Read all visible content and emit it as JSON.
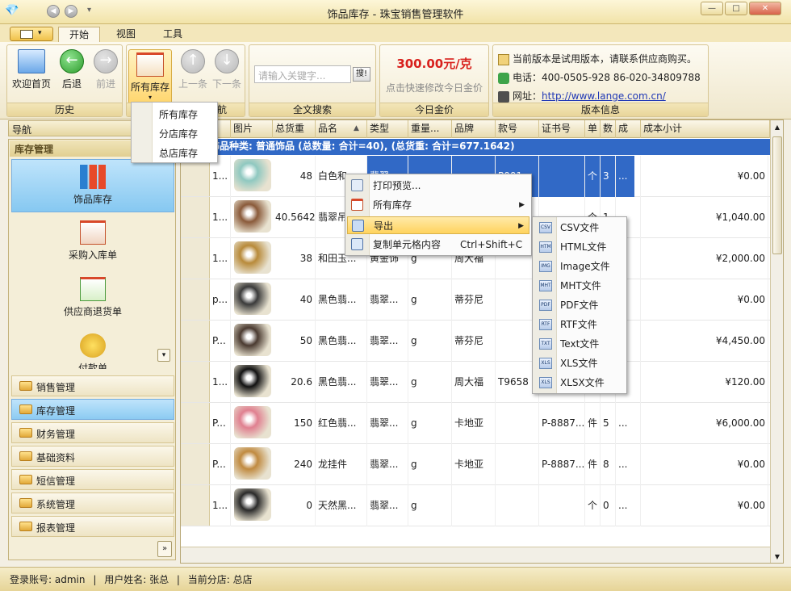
{
  "window": {
    "title": "饰品库存 - 珠宝销售管理软件"
  },
  "tabs": [
    "开始",
    "视图",
    "工具"
  ],
  "ribbon": {
    "history": {
      "home": "欢迎首页",
      "back": "后退",
      "forward": "前进",
      "label": "历史"
    },
    "nav": {
      "all_stock": "所有库存",
      "prev": "上一条",
      "next": "下一条",
      "label": "导航"
    },
    "search": {
      "placeholder": "请输入关键字...",
      "button": "搜!",
      "label": "全文搜索"
    },
    "gold": {
      "price": "300.00元/克",
      "tip": "点击快速修改今日金价",
      "label": "今日金价"
    },
    "version": {
      "notice": "当前版本是试用版本，请联系供应商购买。",
      "phone_label": "电话：",
      "phone": "400-0505-928  86-020-34809788",
      "url_label": "网址：",
      "url": "http://www.lange.com.cn/",
      "label": "版本信息"
    }
  },
  "dropdown": [
    "所有库存",
    "分店库存",
    "总店库存"
  ],
  "sidebar": {
    "header": "导航",
    "section": "库存管理",
    "big_items": [
      "饰品库存",
      "采购入库单",
      "供应商退货单",
      "付款单"
    ],
    "items": [
      "销售管理",
      "库存管理",
      "财务管理",
      "基础资料",
      "短信管理",
      "系统管理",
      "报表管理"
    ]
  },
  "grid": {
    "columns": [
      "图片",
      "总货重",
      "品名",
      "类型",
      "重量...",
      "品牌",
      "款号",
      "证书号",
      "单",
      "数",
      "成",
      "成本小计"
    ],
    "group_row": "饰品种类: 普通饰品 (总数量: 合计=40), (总货重: 合计=677.1642)",
    "rows": [
      {
        "id": "1...",
        "weight": "48",
        "name": "白色和...",
        "type": "翡翠...",
        "unit_w": "",
        "brand": "",
        "style": "P001",
        "cert": "",
        "unit": "个",
        "qty": "3",
        "c": "...",
        "cost": "¥0.00"
      },
      {
        "id": "1...",
        "weight": "40.5642",
        "name": "翡翠吊...",
        "type": "翡翠...",
        "unit_w": "",
        "brand": "",
        "style": "",
        "cert": "",
        "unit": "个",
        "qty": "1",
        "c": "...",
        "cost": "¥1,040.00"
      },
      {
        "id": "1...",
        "weight": "38",
        "name": "和田玉...",
        "type": "黄金饰",
        "unit_w": "g",
        "brand": "周大福",
        "style": "",
        "cert": "",
        "unit": "",
        "qty": "",
        "c": "",
        "cost": "¥2,000.00"
      },
      {
        "id": "p...",
        "weight": "40",
        "name": "黑色翡...",
        "type": "翡翠...",
        "unit_w": "g",
        "brand": "蒂芬尼",
        "style": "",
        "cert": "",
        "unit": "",
        "qty": "",
        "c": "",
        "cost": "¥0.00"
      },
      {
        "id": "P...",
        "weight": "50",
        "name": "黑色翡...",
        "type": "翡翠...",
        "unit_w": "g",
        "brand": "蒂芬尼",
        "style": "",
        "cert": "",
        "unit": "",
        "qty": "",
        "c": "",
        "cost": "¥4,450.00"
      },
      {
        "id": "1...",
        "weight": "20.6",
        "name": "黑色翡...",
        "type": "翡翠...",
        "unit_w": "g",
        "brand": "周大福",
        "style": "T9658",
        "cert": "",
        "unit": "",
        "qty": "",
        "c": "",
        "cost": "¥120.00"
      },
      {
        "id": "P...",
        "weight": "150",
        "name": "红色翡...",
        "type": "翡翠...",
        "unit_w": "g",
        "brand": "卡地亚",
        "style": "",
        "cert": "P-8887...",
        "unit": "件",
        "qty": "5",
        "c": "...",
        "cost": "¥6,000.00"
      },
      {
        "id": "P...",
        "weight": "240",
        "name": "龙挂件",
        "type": "翡翠...",
        "unit_w": "g",
        "brand": "卡地亚",
        "style": "",
        "cert": "P-8887...",
        "unit": "件",
        "qty": "8",
        "c": "...",
        "cost": "¥0.00"
      },
      {
        "id": "1...",
        "weight": "0",
        "name": "天然黑...",
        "type": "翡翠...",
        "unit_w": "g",
        "brand": "",
        "style": "",
        "cert": "",
        "unit": "个",
        "qty": "0",
        "c": "...",
        "cost": "¥0.00"
      }
    ]
  },
  "context_menu": {
    "items": [
      "打印预览...",
      "所有库存",
      "导出",
      "复制单元格内容"
    ],
    "shortcut": "Ctrl+Shift+C"
  },
  "export_menu": [
    {
      "label": "CSV文件",
      "tag": "CSV"
    },
    {
      "label": "HTML文件",
      "tag": "HTM"
    },
    {
      "label": "Image文件",
      "tag": "IMG"
    },
    {
      "label": "MHT文件",
      "tag": "MHT"
    },
    {
      "label": "PDF文件",
      "tag": "PDF"
    },
    {
      "label": "RTF文件",
      "tag": "RTF"
    },
    {
      "label": "Text文件",
      "tag": "TXT"
    },
    {
      "label": "XLS文件",
      "tag": "XLS"
    },
    {
      "label": "XLSX文件",
      "tag": "XLS"
    }
  ],
  "status": {
    "account_label": "登录账号:",
    "account": "admin",
    "user_label": "用户姓名:",
    "user": "张总",
    "branch_label": "当前分店:",
    "branch": "总店"
  }
}
